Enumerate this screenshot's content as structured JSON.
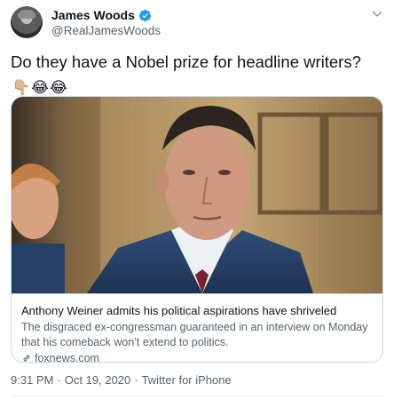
{
  "author": {
    "display_name": "James Woods",
    "handle": "@RealJamesWoods",
    "verified": true,
    "avatar_icon": "user-avatar-photo"
  },
  "tweet": {
    "text": "Do they have a Nobel prize for headline writers?",
    "emojis_line1": [
      "👇🏼",
      "😂",
      "😂"
    ],
    "emojis_line2": [
      "😂",
      "😂"
    ]
  },
  "card": {
    "title": "Anthony Weiner admits his political aspirations have shriveled",
    "description": "The disgraced ex-congressman guaranteed in an interview on Monday that his comeback won’t extend to politics.",
    "domain": "foxnews.com",
    "image_icon": "news-photo"
  },
  "meta": {
    "time": "9:31 PM",
    "date": "Oct 19, 2020",
    "separator": "·",
    "source": "Twitter for iPhone"
  },
  "colors": {
    "verified": "#1d9bf0",
    "secondary_text": "#536471",
    "border": "#cfd9de"
  }
}
